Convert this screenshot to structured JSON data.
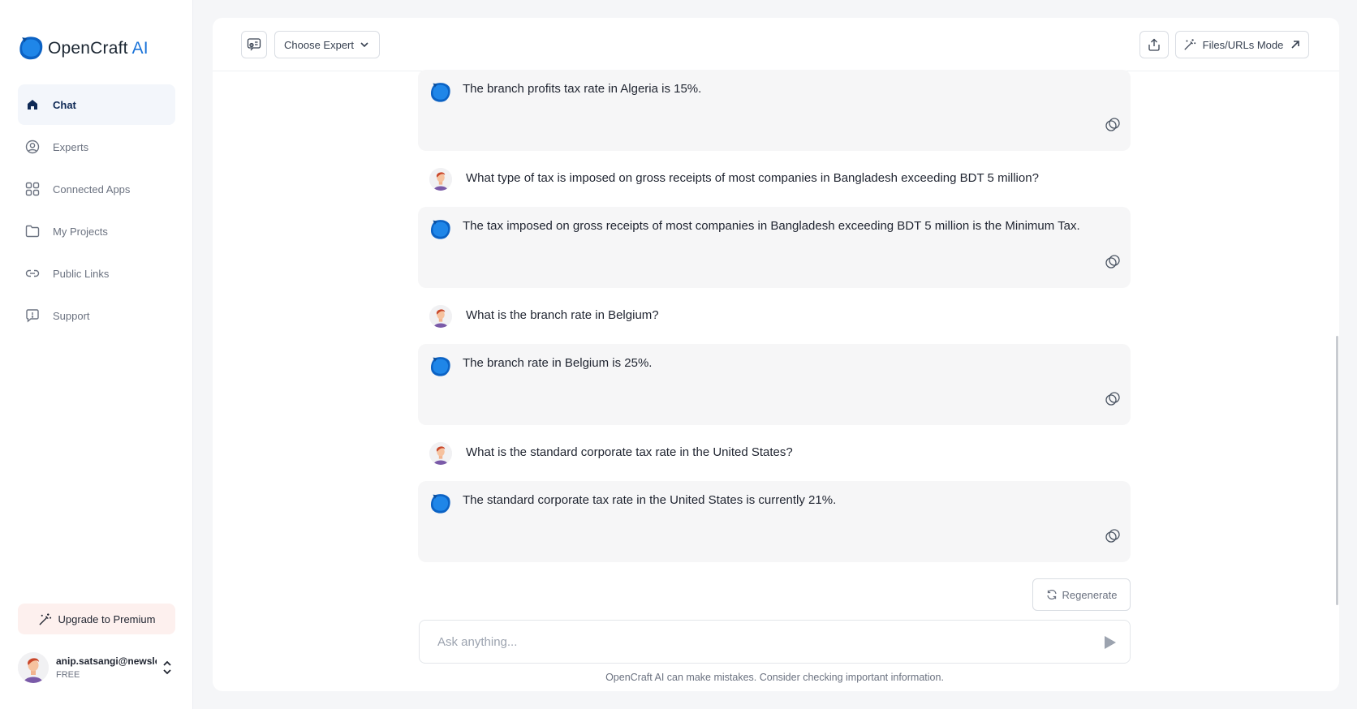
{
  "brand": {
    "name_part1": "OpenCraft ",
    "name_part2": "AI"
  },
  "sidebar": {
    "items": [
      {
        "label": "Chat",
        "icon": "home-icon",
        "active": true
      },
      {
        "label": "Experts",
        "icon": "user-circle-icon"
      },
      {
        "label": "Connected Apps",
        "icon": "grid-icon"
      },
      {
        "label": "My Projects",
        "icon": "folder-icon"
      },
      {
        "label": "Public Links",
        "icon": "link-icon"
      },
      {
        "label": "Support",
        "icon": "support-icon"
      }
    ],
    "upgrade_label": "Upgrade to Premium",
    "user": {
      "email": "anip.satsangi@newsletter",
      "plan": "FREE"
    }
  },
  "toolbar": {
    "choose_expert_label": "Choose Expert",
    "files_mode_label": "Files/URLs Mode"
  },
  "messages": [
    {
      "role": "ai",
      "text": "The branch profits tax rate in Algeria is 15%."
    },
    {
      "role": "user",
      "text": "What type of tax is imposed on gross receipts of most companies in Bangladesh exceeding BDT 5 million?"
    },
    {
      "role": "ai",
      "text": "The tax imposed on gross receipts of most companies in Bangladesh exceeding BDT 5 million is the Minimum Tax."
    },
    {
      "role": "user",
      "text": "What is the branch rate in Belgium?"
    },
    {
      "role": "ai",
      "text": "The branch rate in Belgium is 25%."
    },
    {
      "role": "user",
      "text": "What is the standard corporate tax rate in the United States?"
    },
    {
      "role": "ai",
      "text": "The standard corporate tax rate in the United States is currently 21%."
    }
  ],
  "regenerate_label": "Regenerate",
  "composer": {
    "placeholder": "Ask anything..."
  },
  "disclaimer": "OpenCraft AI can make mistakes. Consider checking important information.",
  "colors": {
    "accent": "#1a73d9",
    "active_nav_text": "#0f2a56",
    "upgrade_bg": "#fdf0ee"
  }
}
